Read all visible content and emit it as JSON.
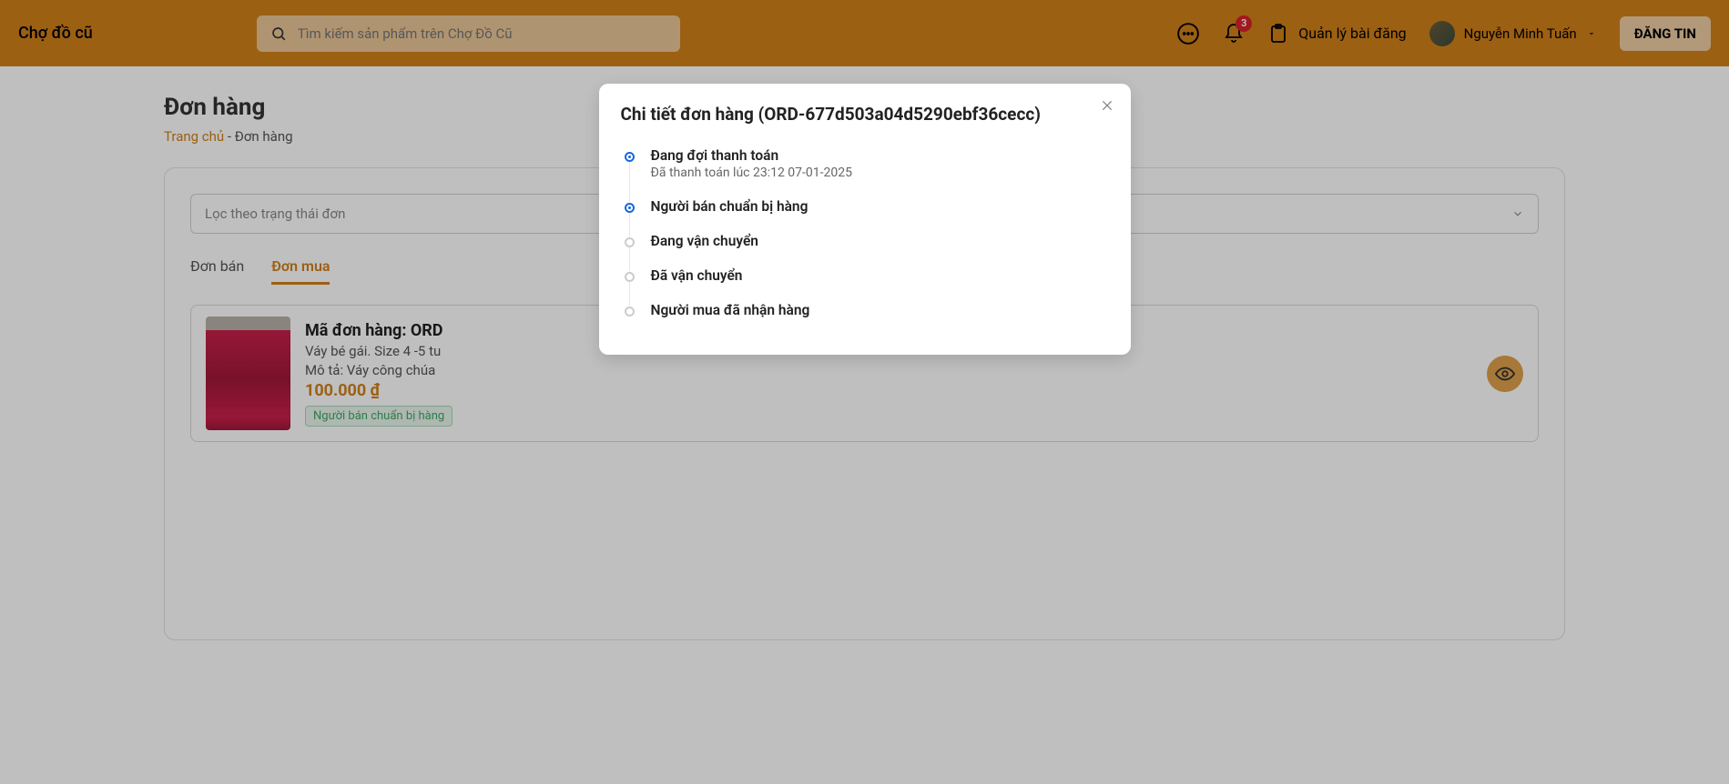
{
  "header": {
    "logo": "Chợ đồ cũ",
    "search_placeholder": "Tìm kiếm sản phẩm trên Chợ Đồ Cũ",
    "notif_badge": "3",
    "manage_posts": "Quản lý bài đăng",
    "user_name": "Nguyễn Minh Tuấn",
    "post_button": "ĐĂNG TIN"
  },
  "page": {
    "title": "Đơn hàng",
    "home_link": "Trang chủ",
    "breadcrumb_sep": " - ",
    "breadcrumb_current": "Đơn hàng"
  },
  "filter": {
    "placeholder": "Lọc theo trạng thái đơn"
  },
  "tabs": {
    "sell": "Đơn bán",
    "buy": "Đơn mua"
  },
  "order": {
    "code_label": "Mã đơn hàng: ORD",
    "product": "Váy bé gái. Size 4 -5 tu",
    "desc": "Mô tả: Váy công chúa",
    "price": "100.000 ₫",
    "status": "Người bán chuẩn bị hàng"
  },
  "modal": {
    "title": "Chi tiết đơn hàng (ORD-677d503a04d5290ebf36cecc)",
    "steps": [
      {
        "title": "Đang đợi thanh toán",
        "sub": "Đã thanh toán lúc 23:12 07-01-2025",
        "done": true
      },
      {
        "title": "Người bán chuẩn bị hàng",
        "sub": "",
        "done": true
      },
      {
        "title": "Đang vận chuyển",
        "sub": "",
        "done": false
      },
      {
        "title": "Đã vận chuyển",
        "sub": "",
        "done": false
      },
      {
        "title": "Người mua đã nhận hàng",
        "sub": "",
        "done": false
      }
    ]
  }
}
